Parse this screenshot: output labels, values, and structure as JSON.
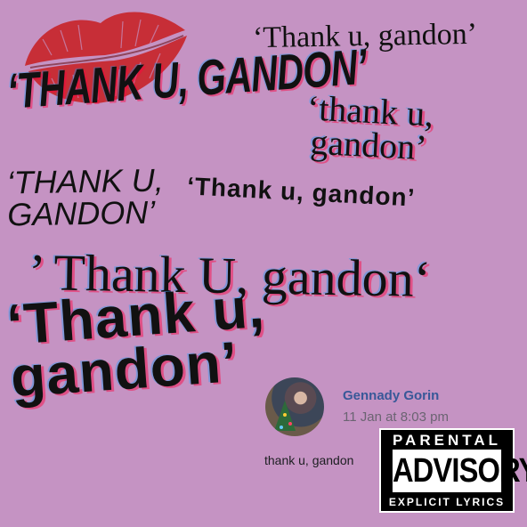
{
  "colors": {
    "background": "#c593c3",
    "lips": "#c8262c",
    "name": "#385898"
  },
  "lines": [
    "‘Thank u, gandon’",
    "‘THANK U, GANDON’",
    "‘thank u,\ngandon’",
    "‘THANK U,\nGANDON’",
    "‘Thank u, gandon’",
    "’ Thank U, gandon‘",
    "‘Thank u,\ngandon’"
  ],
  "comment": {
    "name": "Gennady Gorin",
    "time": "11 Jan at 8:03 pm",
    "text": "thank u, gandon"
  },
  "advisory": {
    "top": "PARENTAL",
    "middle": "ADVISORY",
    "bottom": "EXPLICIT LYRICS"
  }
}
